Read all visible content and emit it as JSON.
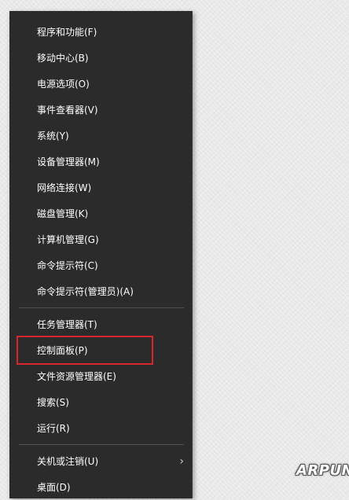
{
  "menu": {
    "items": [
      {
        "label": "程序和功能(F)"
      },
      {
        "label": "移动中心(B)"
      },
      {
        "label": "电源选项(O)"
      },
      {
        "label": "事件查看器(V)"
      },
      {
        "label": "系统(Y)"
      },
      {
        "label": "设备管理器(M)"
      },
      {
        "label": "网络连接(W)"
      },
      {
        "label": "磁盘管理(K)"
      },
      {
        "label": "计算机管理(G)"
      },
      {
        "label": "命令提示符(C)"
      },
      {
        "label": "命令提示符(管理员)(A)"
      },
      {
        "label": "任务管理器(T)"
      },
      {
        "label": "控制面板(P)"
      },
      {
        "label": "文件资源管理器(E)"
      },
      {
        "label": "搜索(S)"
      },
      {
        "label": "运行(R)"
      },
      {
        "label": "关机或注销(U)"
      },
      {
        "label": "桌面(D)"
      }
    ],
    "submenu_arrow": "›"
  },
  "highlight_color": "#d9262c",
  "watermark": "ARPUN"
}
